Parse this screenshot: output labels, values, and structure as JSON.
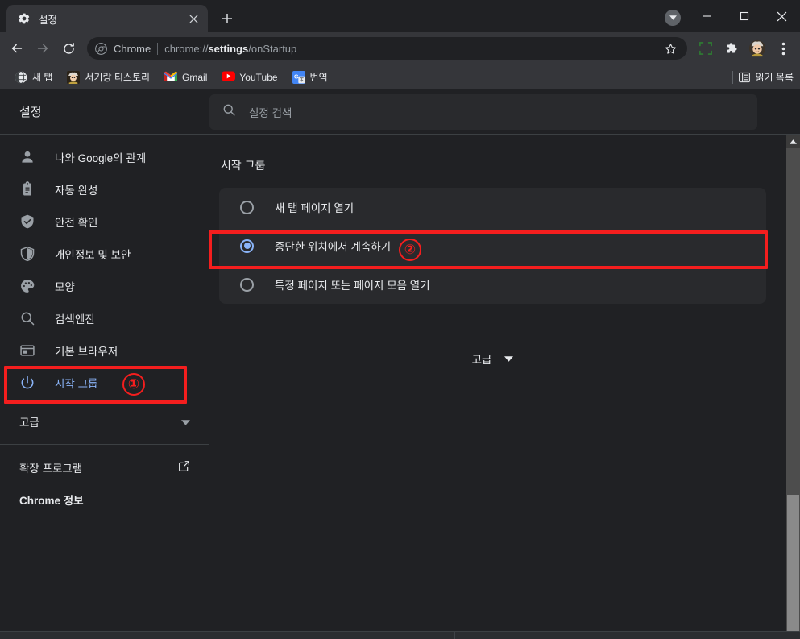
{
  "window": {
    "minimize_label": "—",
    "maximize_label": "□",
    "close_label": "✕"
  },
  "tabstrip": {
    "tabs": [
      {
        "title": "설정",
        "favicon": "gear-icon",
        "close_label": "✕"
      }
    ],
    "new_tab_label": "+"
  },
  "toolbar": {
    "back_icon": "back-arrow-icon",
    "forward_icon": "forward-arrow-icon",
    "reload_icon": "reload-icon",
    "omnibox": {
      "chip_icon": "chrome-logo-icon",
      "chip_label": "Chrome",
      "url_prefix": "chrome://",
      "url_bold": "settings",
      "url_suffix": "/onStartup",
      "star_icon": "bookmark-star-icon"
    },
    "capture_icon": "screen-capture-icon",
    "extensions_icon": "puzzle-piece-icon",
    "profile_icon": "profile-avatar-icon",
    "menu_icon": "three-dot-menu-icon"
  },
  "bookmarks": {
    "items": [
      {
        "label": "새 탭",
        "icon": "globe-icon"
      },
      {
        "label": "서기랑 티스토리",
        "icon": "tistory-avatar-icon"
      },
      {
        "label": "Gmail",
        "icon": "gmail-icon"
      },
      {
        "label": "YouTube",
        "icon": "youtube-icon"
      },
      {
        "label": "번역",
        "icon": "google-translate-icon"
      }
    ],
    "reading_list_label": "읽기 목록",
    "reading_list_icon": "reading-list-icon"
  },
  "settings": {
    "title": "설정",
    "search_placeholder": "설정 검색",
    "search_icon": "search-icon",
    "search_value": ""
  },
  "sidebar": {
    "items": [
      {
        "label": "나와 Google의 관계",
        "icon": "person-icon",
        "active": false
      },
      {
        "label": "자동 완성",
        "icon": "clipboard-icon",
        "active": false
      },
      {
        "label": "안전 확인",
        "icon": "shield-check-icon",
        "active": false
      },
      {
        "label": "개인정보 및 보안",
        "icon": "shield-icon",
        "active": false
      },
      {
        "label": "모양",
        "icon": "palette-icon",
        "active": false
      },
      {
        "label": "검색엔진",
        "icon": "magnifier-icon",
        "active": false
      },
      {
        "label": "기본 브라우저",
        "icon": "browser-window-icon",
        "active": false
      },
      {
        "label": "시작 그룹",
        "icon": "power-icon",
        "active": true
      }
    ],
    "advanced_group": {
      "label": "고급",
      "icon": "chevron-down-icon"
    },
    "extensions_link": {
      "label": "확장 프로그램",
      "icon": "external-link-icon"
    },
    "about_link": {
      "label": "Chrome 정보"
    }
  },
  "main": {
    "section_title": "시작 그룹",
    "radio_options": [
      {
        "label": "새 탭 페이지 열기",
        "selected": false
      },
      {
        "label": "중단한 위치에서 계속하기",
        "selected": true
      },
      {
        "label": "특정 페이지 또는 페이지 모음 열기",
        "selected": false
      }
    ],
    "advanced_toggle": {
      "label": "고급",
      "icon": "chevron-down-icon"
    }
  },
  "annotations": [
    {
      "number": "①",
      "target": "sidebar-item-startup"
    },
    {
      "number": "②",
      "target": "radio-option-continue"
    }
  ],
  "colors": {
    "accent_blue": "#8ab4f8",
    "annotation_red": "#f41e1e",
    "window_bg": "#202124",
    "toolbar_bg": "#35363a",
    "card_bg": "#292a2d"
  }
}
